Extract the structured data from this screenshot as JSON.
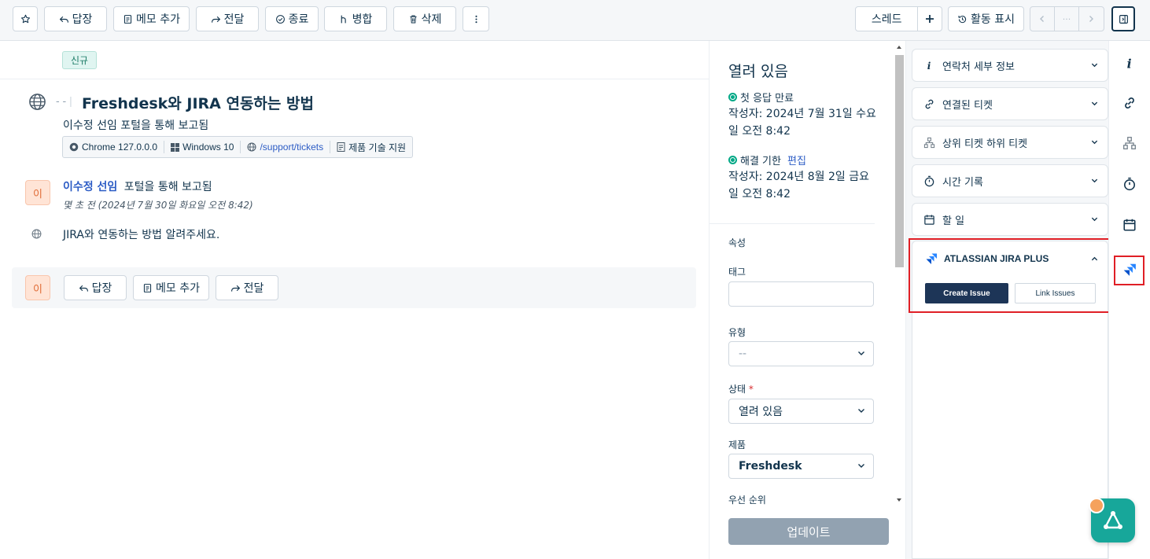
{
  "toolbar": {
    "reply": "답장",
    "add_note": "메모 추가",
    "forward": "전달",
    "close": "종료",
    "merge": "병합",
    "delete": "삭제",
    "thread": "스레드",
    "activity": "활동 표시",
    "nav_middle": "···"
  },
  "ticket": {
    "status_badge": "신규",
    "dash": "- -",
    "title": "Freshdesk와 JIRA 연동하는 방법",
    "reported_via": "이수정 선임  포털을 통해 보고됨",
    "browser": "Chrome 127.0.0.0",
    "os": "Windows 10",
    "url": "/support/tickets",
    "product": "제품 기술 지원"
  },
  "message": {
    "avatar": "이",
    "author": "이수정 선임",
    "via": "포털을 통해 보고됨",
    "time": "몇 초 전 (2024년 7월 30일 화요일 오전 8:42)",
    "body": "JIRA와 연동하는 방법 알려주세요."
  },
  "reply_bar": {
    "avatar": "이",
    "reply": "답장",
    "add_note": "메모 추가",
    "forward": "전달"
  },
  "properties": {
    "status_title": "열려 있음",
    "first_response_label": "첫 응답 만료",
    "first_response_date": "작성자: 2024년 7월 31일 수요일 오전 8:42",
    "resolution_label": "해결 기한",
    "edit": "편집",
    "resolution_date": "작성자: 2024년 8월 2일 금요일 오전 8:42",
    "section": "속성",
    "tags_label": "태그",
    "tags_value": "",
    "type_label": "유형",
    "type_value": "--",
    "status_label": "상태",
    "required_mark": "*",
    "status_value": "열려 있음",
    "product_label": "제품",
    "product_value": "Freshdesk",
    "priority_label": "우선 순위",
    "update_button": "업데이트"
  },
  "apps": {
    "contact_details": "연락처 세부 정보",
    "linked_tickets": "연결된 티켓",
    "parent_child": "상위 티켓 하위 티켓",
    "time_logs": "시간 기록",
    "todo": "할 일",
    "jira_title": "ATLASSIAN JIRA PLUS",
    "create_issue": "Create Issue",
    "link_issues": "Link Issues"
  },
  "colors": {
    "accent_link": "#2c5cc5",
    "highlight_red": "#e01f26",
    "jira_blue": "#2684ff",
    "sla_green": "#00a886",
    "fab_teal": "#17a79a"
  }
}
